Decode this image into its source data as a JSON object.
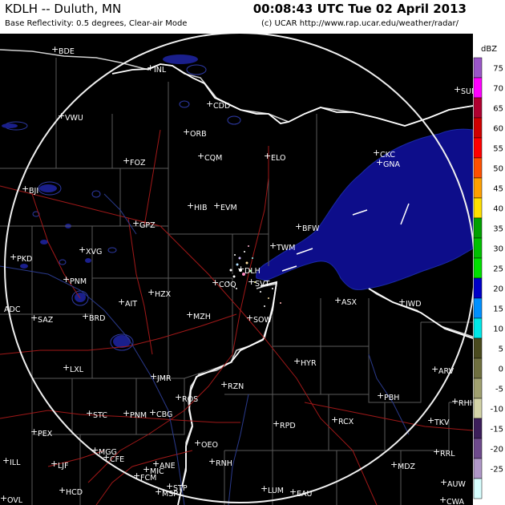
{
  "header": {
    "station": "KDLH -- Duluth, MN",
    "product": "Base Reflectivity: 0.5 degrees, Clear-air Mode",
    "timestamp": "00:08:43 UTC Tue 02 April 2013",
    "credit": "(c) UCAR  http://www.rap.ucar.edu/weather/radar/"
  },
  "legend": {
    "unit": "dBZ",
    "levels": [
      {
        "value": "75",
        "color": "#9a56c8"
      },
      {
        "value": "70",
        "color": "#ff00ff"
      },
      {
        "value": "65",
        "color": "#b00030"
      },
      {
        "value": "60",
        "color": "#d00000"
      },
      {
        "value": "55",
        "color": "#ff0000"
      },
      {
        "value": "50",
        "color": "#ff5000"
      },
      {
        "value": "45",
        "color": "#ffa000"
      },
      {
        "value": "40",
        "color": "#ffe000"
      },
      {
        "value": "35",
        "color": "#00a000"
      },
      {
        "value": "30",
        "color": "#00c000"
      },
      {
        "value": "25",
        "color": "#00e000"
      },
      {
        "value": "20",
        "color": "#0000c8"
      },
      {
        "value": "15",
        "color": "#0090ff"
      },
      {
        "value": "10",
        "color": "#00e8e8"
      },
      {
        "value": "5",
        "color": "#4a4a1e"
      },
      {
        "value": "0",
        "color": "#707040"
      },
      {
        "value": "-5",
        "color": "#a0a070"
      },
      {
        "value": "-10",
        "color": "#d4d4a8"
      },
      {
        "value": "-15",
        "color": "#3c1e5a"
      },
      {
        "value": "-20",
        "color": "#6e4a8c"
      },
      {
        "value": "-25",
        "color": "#b098c8"
      },
      {
        "value": "",
        "color": "#d8ffff"
      }
    ]
  },
  "map": {
    "lake_name_hidden": "",
    "cities": [
      {
        "id": "inl",
        "label": "INL"
      },
      {
        "id": "bde",
        "label": "BDE"
      },
      {
        "id": "cdd",
        "label": "CDD"
      },
      {
        "id": "vwu",
        "label": "VWU"
      },
      {
        "id": "orb",
        "label": "ORB"
      },
      {
        "id": "cqm",
        "label": "CQM"
      },
      {
        "id": "elo",
        "label": "ELO"
      },
      {
        "id": "foz",
        "label": "FOZ"
      },
      {
        "id": "ckc",
        "label": "CKC"
      },
      {
        "id": "gna",
        "label": "GNA"
      },
      {
        "id": "bji",
        "label": "BJI"
      },
      {
        "id": "hib",
        "label": "HIB"
      },
      {
        "id": "evm",
        "label": "EVM"
      },
      {
        "id": "gpz",
        "label": "GPZ"
      },
      {
        "id": "bfw",
        "label": "BFW"
      },
      {
        "id": "pkd",
        "label": "PKD"
      },
      {
        "id": "xvg",
        "label": "XVG"
      },
      {
        "id": "twm",
        "label": "TWM"
      },
      {
        "id": "dlh",
        "label": "DLH"
      },
      {
        "id": "pnm",
        "label": "PNM"
      },
      {
        "id": "cou",
        "label": "COQ"
      },
      {
        "id": "svt",
        "label": "SVT"
      },
      {
        "id": "hzx",
        "label": "HZX"
      },
      {
        "id": "ait",
        "label": "AIT"
      },
      {
        "id": "asx",
        "label": "ASX"
      },
      {
        "id": "iwd",
        "label": "IWD"
      },
      {
        "id": "adc",
        "label": "ADC"
      },
      {
        "id": "saz",
        "label": "SAZ"
      },
      {
        "id": "brd",
        "label": "BRD"
      },
      {
        "id": "mzh",
        "label": "MZH"
      },
      {
        "id": "sow",
        "label": "SOW"
      },
      {
        "id": "hyr",
        "label": "HYR"
      },
      {
        "id": "lxl",
        "label": "LXL"
      },
      {
        "id": "jmr",
        "label": "JMR"
      },
      {
        "id": "arv",
        "label": "ARV"
      },
      {
        "id": "rzn",
        "label": "RZN"
      },
      {
        "id": "ros",
        "label": "ROS"
      },
      {
        "id": "pbh",
        "label": "PBH"
      },
      {
        "id": "rhi",
        "label": "RHI"
      },
      {
        "id": "stc",
        "label": "STC"
      },
      {
        "id": "pnm2",
        "label": "PNM"
      },
      {
        "id": "cbg",
        "label": "CBG"
      },
      {
        "id": "rpd",
        "label": "RPD"
      },
      {
        "id": "rcx",
        "label": "RCX"
      },
      {
        "id": "tkv",
        "label": "TKV"
      },
      {
        "id": "pex",
        "label": "PEX"
      },
      {
        "id": "ill",
        "label": "ILL"
      },
      {
        "id": "mgg",
        "label": "MGG"
      },
      {
        "id": "cfe",
        "label": "CFE"
      },
      {
        "id": "oeo",
        "label": "OEO"
      },
      {
        "id": "ljf",
        "label": "LJF"
      },
      {
        "id": "rnh",
        "label": "RNH"
      },
      {
        "id": "rrl",
        "label": "RRL"
      },
      {
        "id": "anf",
        "label": "ANE"
      },
      {
        "id": "mic",
        "label": "MIC"
      },
      {
        "id": "mdz",
        "label": "MDZ"
      },
      {
        "id": "hcd",
        "label": "HCD"
      },
      {
        "id": "fcm",
        "label": "FCM"
      },
      {
        "id": "stp",
        "label": "STP"
      },
      {
        "id": "msp",
        "label": "MSP"
      },
      {
        "id": "ovl",
        "label": "OVL"
      },
      {
        "id": "lum",
        "label": "LUM"
      },
      {
        "id": "eau",
        "label": "EAU"
      },
      {
        "id": "auw",
        "label": "AUW"
      },
      {
        "id": "cwa",
        "label": "CWA"
      },
      {
        "id": "sum",
        "label": "SUM"
      }
    ]
  }
}
